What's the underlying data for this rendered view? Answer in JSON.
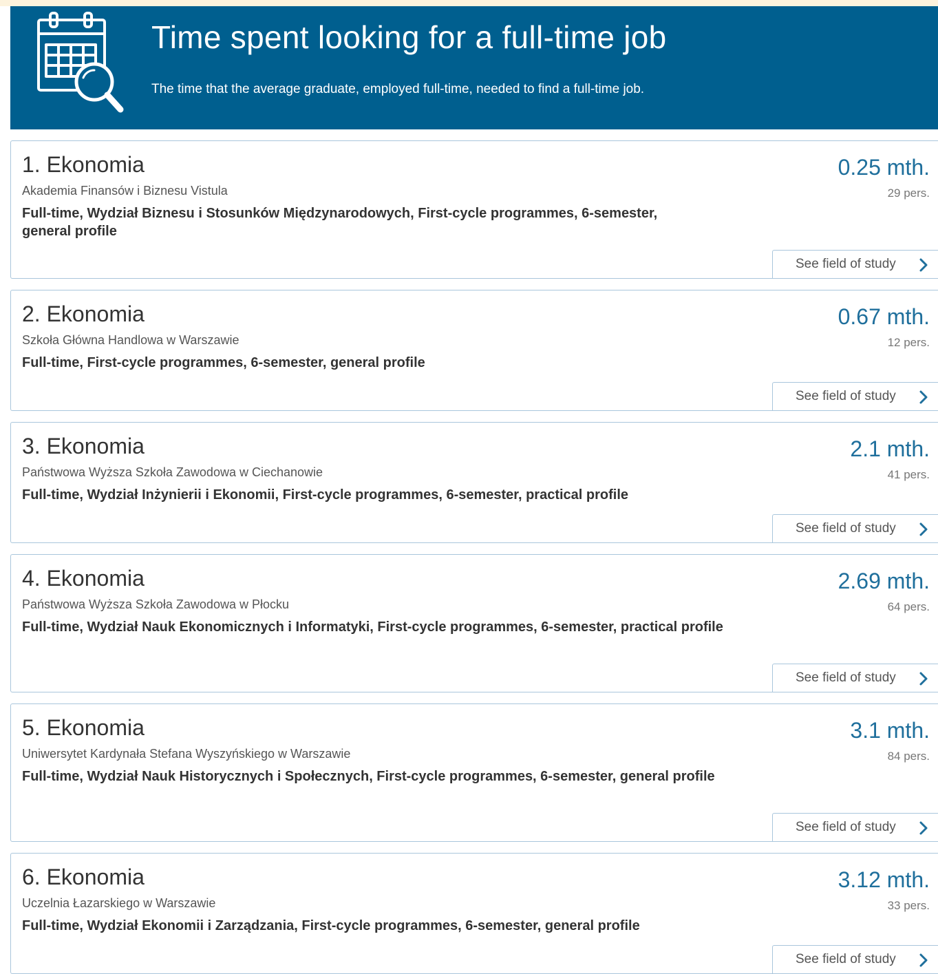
{
  "header": {
    "title": "Time spent looking for a full-time job",
    "subtitle": "The time that the average graduate, employed full-time, needed to find a full-time job.",
    "icon": "calendar-search-icon"
  },
  "colors": {
    "header_bg": "#005f8f",
    "value_text": "#1f6f9c",
    "card_border": "#a9c6dc"
  },
  "cards": [
    {
      "title": "1. Ekonomia",
      "university": "Akademia Finansów i Biznesu Vistula",
      "details": "Full-time, Wydział Biznesu i Stosunków Międzynarodowych, First-cycle programmes, 6-semester, general profile",
      "value": "0.25 mth.",
      "people": "29 pers.",
      "button": "See field of study"
    },
    {
      "title": "2. Ekonomia",
      "university": "Szkoła Główna Handlowa w Warszawie",
      "details": "Full-time, First-cycle programmes, 6-semester, general profile",
      "value": "0.67 mth.",
      "people": "12 pers.",
      "button": "See field of study"
    },
    {
      "title": "3. Ekonomia",
      "university": "Państwowa Wyższa Szkoła Zawodowa w Ciechanowie",
      "details": "Full-time, Wydział Inżynierii i Ekonomii, First-cycle programmes, 6-semester, practical profile",
      "value": "2.1 mth.",
      "people": "41 pers.",
      "button": "See field of study"
    },
    {
      "title": "4. Ekonomia",
      "university": "Państwowa Wyższa Szkoła Zawodowa w Płocku",
      "details": "Full-time, Wydział Nauk Ekonomicznych i Informatyki, First-cycle programmes, 6-semester, practical profile",
      "value": "2.69 mth.",
      "people": "64 pers.",
      "button": "See field of study"
    },
    {
      "title": "5. Ekonomia",
      "university": "Uniwersytet Kardynała Stefana Wyszyńskiego w Warszawie",
      "details": "Full-time, Wydział Nauk Historycznych i Społecznych, First-cycle programmes, 6-semester, general profile",
      "value": "3.1 mth.",
      "people": "84 pers.",
      "button": "See field of study"
    },
    {
      "title": "6. Ekonomia",
      "university": "Uczelnia Łazarskiego w Warszawie",
      "details": "Full-time, Wydział Ekonomii i Zarządzania, First-cycle programmes, 6-semester, general profile",
      "value": "3.12 mth.",
      "people": "33 pers.",
      "button": "See field of study"
    }
  ]
}
